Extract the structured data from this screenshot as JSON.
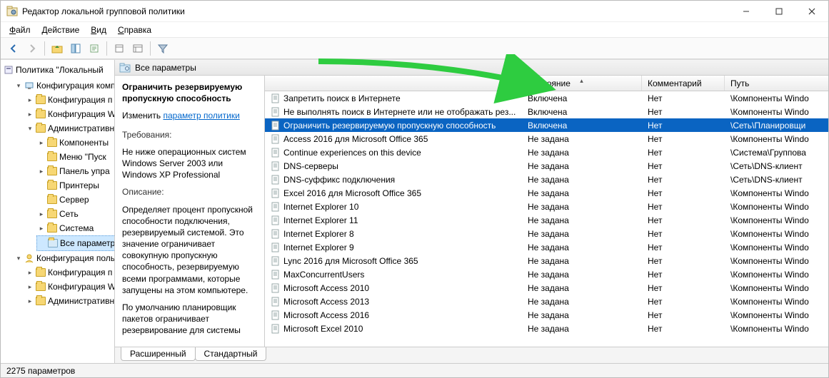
{
  "title": "Редактор локальной групповой политики",
  "menubar": [
    "Файл",
    "Действие",
    "Вид",
    "Справка"
  ],
  "toolbar_icons": [
    "back",
    "forward",
    "up-folder",
    "props-list",
    "export",
    "refresh",
    "props",
    "help",
    "filter"
  ],
  "tree": {
    "root": "Политика \"Локальный",
    "computer_conf": "Конфигурация комп",
    "user_conf": "Конфигурация поль",
    "nodes_comp": [
      "Конфигурация п",
      "Конфигурация W",
      "Административн"
    ],
    "admin_children": [
      "Компоненты",
      "Меню \"Пуск",
      "Панель упра",
      "Принтеры",
      "Сервер",
      "Сеть",
      "Система",
      "Все параметр"
    ],
    "nodes_user": [
      "Конфигурация п",
      "Конфигурация W",
      "Административн"
    ]
  },
  "pane_header": "Все параметры",
  "detail": {
    "title": "Ограничить резервируемую пропускную способность",
    "edit_prefix": "Изменить ",
    "edit_link": "параметр политики",
    "req_label": "Требования:",
    "req_text": "Не ниже операционных систем Windows Server 2003 или Windows XP Professional",
    "desc_label": "Описание:",
    "desc_text": "Определяет процент пропускной способности подключения, резервируемый системой. Это значение ограничивает совокупную пропускную способность, резервируемую всеми программами, которые запущены на этом компьютере.",
    "desc_text2": "По умолчанию планировщик пакетов ограничивает резервирование для системы"
  },
  "columns": {
    "state": "Состояние",
    "comment": "Комментарий",
    "path": "Путь"
  },
  "rows": [
    {
      "name": "Запретить поиск в Интернете",
      "state": "Включена",
      "comment": "Нет",
      "path": "\\Компоненты Windo"
    },
    {
      "name": "Не выполнять поиск в Интернете или не отображать рез...",
      "state": "Включена",
      "comment": "Нет",
      "path": "\\Компоненты Windo"
    },
    {
      "name": "Ограничить резервируемую пропускную способность",
      "state": "Включена",
      "comment": "Нет",
      "path": "\\Сеть\\Планировщи",
      "selected": true
    },
    {
      "name": "Access 2016 для Microsoft Office 365",
      "state": "Не задана",
      "comment": "Нет",
      "path": "\\Компоненты Windo"
    },
    {
      "name": "Continue experiences on this device",
      "state": "Не задана",
      "comment": "Нет",
      "path": "\\Система\\Группова"
    },
    {
      "name": "DNS-серверы",
      "state": "Не задана",
      "comment": "Нет",
      "path": "\\Сеть\\DNS-клиент"
    },
    {
      "name": "DNS-суффикс подключения",
      "state": "Не задана",
      "comment": "Нет",
      "path": "\\Сеть\\DNS-клиент"
    },
    {
      "name": "Excel 2016 для Microsoft Office 365",
      "state": "Не задана",
      "comment": "Нет",
      "path": "\\Компоненты Windo"
    },
    {
      "name": "Internet Explorer 10",
      "state": "Не задана",
      "comment": "Нет",
      "path": "\\Компоненты Windo"
    },
    {
      "name": "Internet Explorer 11",
      "state": "Не задана",
      "comment": "Нет",
      "path": "\\Компоненты Windo"
    },
    {
      "name": "Internet Explorer 8",
      "state": "Не задана",
      "comment": "Нет",
      "path": "\\Компоненты Windo"
    },
    {
      "name": "Internet Explorer 9",
      "state": "Не задана",
      "comment": "Нет",
      "path": "\\Компоненты Windo"
    },
    {
      "name": "Lync 2016 для Microsoft Office 365",
      "state": "Не задана",
      "comment": "Нет",
      "path": "\\Компоненты Windo"
    },
    {
      "name": "MaxConcurrentUsers",
      "state": "Не задана",
      "comment": "Нет",
      "path": "\\Компоненты Windo"
    },
    {
      "name": "Microsoft Access 2010",
      "state": "Не задана",
      "comment": "Нет",
      "path": "\\Компоненты Windo"
    },
    {
      "name": "Microsoft Access 2013",
      "state": "Не задана",
      "comment": "Нет",
      "path": "\\Компоненты Windo"
    },
    {
      "name": "Microsoft Access 2016",
      "state": "Не задана",
      "comment": "Нет",
      "path": "\\Компоненты Windo"
    },
    {
      "name": "Microsoft Excel 2010",
      "state": "Не задана",
      "comment": "Нет",
      "path": "\\Компоненты Windo"
    }
  ],
  "tabs": {
    "extended": "Расширенный",
    "standard": "Стандартный"
  },
  "status": "2275 параметров"
}
